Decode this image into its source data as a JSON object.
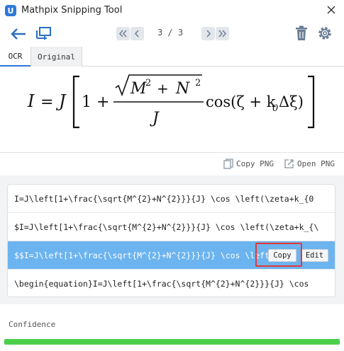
{
  "window": {
    "logo_letter": "U",
    "title": "Mathpix Snipping Tool",
    "close_icon": "close-icon"
  },
  "toolbar": {
    "back_icon": "back-arrow-icon",
    "screen_icon": "screen-capture-icon",
    "first_icon": "double-chevron-left-icon",
    "prev_icon": "chevron-left-icon",
    "next_icon": "chevron-right-icon",
    "last_icon": "double-chevron-right-icon",
    "page_indicator": "3 / 3",
    "trash_icon": "trash-icon",
    "settings_icon": "gear-icon"
  },
  "tabs": [
    {
      "label": "OCR",
      "active": true
    },
    {
      "label": "Original",
      "active": false
    }
  ],
  "formula": {
    "lhs_I": "I",
    "equals": "=",
    "J": "J",
    "one_plus": "1 +",
    "numerator": "M² + N²",
    "M": "M",
    "N": "N",
    "sup2": "2",
    "plus": "+",
    "denominator": "J",
    "cos_part": "cos(ζ + k",
    "sub0": "0",
    "tail": "Δξ)"
  },
  "png_actions": {
    "copy_png": "Copy PNG",
    "open_png": "Open PNG"
  },
  "latex_list": [
    {
      "text": "I=J\\left[1+\\frac{\\sqrt{M^{2}+N^{2}}}{J} \\cos \\left(\\zeta+k_{0"
    },
    {
      "text": "$I=J\\left[1+\\frac{\\sqrt{M^{2}+N^{2}}}{J} \\cos \\left(\\zeta+k_{\\"
    },
    {
      "text": "$$I=J\\left[1+\\frac{\\sqrt{M^{2}+N^{2}}}{J} \\cos \\left(\\ze",
      "selected": true,
      "copy_label": "Copy",
      "edit_label": "Edit"
    },
    {
      "text": "\\begin{equation}I=J\\left[1+\\frac{\\sqrt{M^{2}+N^{2}}}{J} \\cos"
    }
  ],
  "confidence": {
    "label": "Confidence",
    "value": 1.0,
    "color": "#4cd04c"
  },
  "colors": {
    "accent": "#2f78d6",
    "selected_row": "#6cb4ef",
    "highlight": "#e53935"
  }
}
